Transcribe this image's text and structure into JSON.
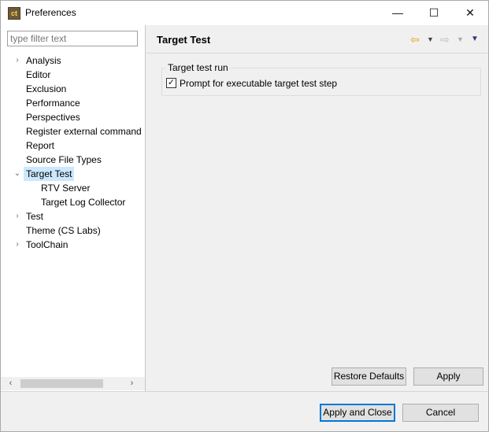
{
  "window": {
    "title": "Preferences",
    "icon_label": "ct",
    "minimize": "—",
    "maximize": "☐",
    "close": "✕"
  },
  "filter": {
    "placeholder": "type filter text",
    "value": ""
  },
  "tree": {
    "items": [
      {
        "label": "Analysis",
        "expander": "›",
        "selected": false
      },
      {
        "label": "Editor",
        "expander": "",
        "selected": false
      },
      {
        "label": "Exclusion",
        "expander": "",
        "selected": false
      },
      {
        "label": "Performance",
        "expander": "",
        "selected": false
      },
      {
        "label": "Perspectives",
        "expander": "",
        "selected": false
      },
      {
        "label": "Register external command",
        "expander": "",
        "selected": false
      },
      {
        "label": "Report",
        "expander": "",
        "selected": false
      },
      {
        "label": "Source File Types",
        "expander": "",
        "selected": false
      },
      {
        "label": "Target Test",
        "expander": "⌄",
        "selected": true
      },
      {
        "label": "RTV Server",
        "expander": "",
        "selected": false
      },
      {
        "label": "Target Log Collector",
        "expander": "",
        "selected": false
      },
      {
        "label": "Test",
        "expander": "›",
        "selected": false
      },
      {
        "label": "Theme (CS Labs)",
        "expander": "",
        "selected": false
      },
      {
        "label": "ToolChain",
        "expander": "›",
        "selected": false
      }
    ]
  },
  "scroll": {
    "left_arrow": "‹",
    "right_arrow": "›"
  },
  "page": {
    "title": "Target Test",
    "nav_back": "⇦",
    "nav_forward": "⇨",
    "menu_arrow": "▼",
    "view_menu": "▼",
    "group_title": "Target test run",
    "checkbox_label": "Prompt for executable target test step",
    "checkbox_checked": true,
    "checkbox_mark": "✓",
    "restore_defaults": "Restore Defaults",
    "apply": "Apply"
  },
  "footer": {
    "apply_and_close": "Apply and Close",
    "cancel": "Cancel"
  },
  "colors": {
    "selection": "#cce8ff",
    "default_button_border": "#0078d7",
    "back_arrow": "#e3a21a"
  }
}
